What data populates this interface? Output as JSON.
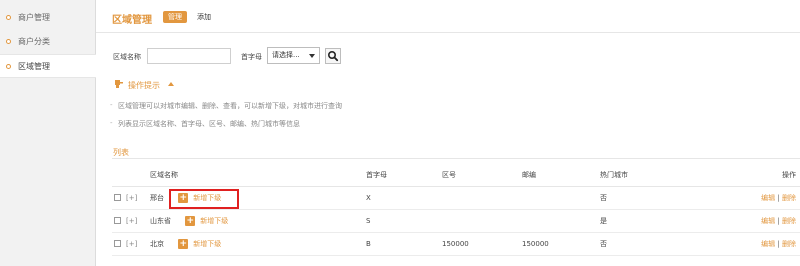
{
  "sidebar": {
    "items": [
      {
        "label": "商户管理"
      },
      {
        "label": "商户分类"
      },
      {
        "label": "区域管理"
      }
    ]
  },
  "header": {
    "title": "区域管理",
    "tab_manage": "管理",
    "tab_add": "添加"
  },
  "search": {
    "region_label": "区域名称",
    "region_value": "",
    "initial_label": "首字母",
    "initial_selected": "请选择..."
  },
  "tips": {
    "title": "操作提示",
    "items": [
      "区域管理可以对城市编辑、删除、查看，可以新增下级，对城市进行查询",
      "列表显示区域名称、首字母、区号、邮编、热门城市等信息"
    ]
  },
  "list": {
    "title": "列表",
    "columns": [
      "区域名称",
      "首字母",
      "区号",
      "邮编",
      "热门城市",
      "操作"
    ],
    "add_sub_label": "新增下级",
    "expand_label": "[+]",
    "edit_label": "编辑",
    "separator": "|",
    "delete_label": "删除",
    "rows": [
      {
        "name": "邢台",
        "initial": "X",
        "area_code": "",
        "zip": "",
        "hot": "否"
      },
      {
        "name": "山东省",
        "initial": "S",
        "area_code": "",
        "zip": "",
        "hot": "是"
      },
      {
        "name": "北京",
        "initial": "B",
        "area_code": "150000",
        "zip": "150000",
        "hot": "否"
      }
    ]
  },
  "colors": {
    "accent": "#e2973f",
    "highlight_box": "#e02020"
  },
  "icons": {
    "sidebar_bullet": "circle-bullet-icon",
    "tips": "lightbulb-icon",
    "collapse": "caret-up-icon",
    "search": "magnifier-icon",
    "add": "plus-icon"
  }
}
